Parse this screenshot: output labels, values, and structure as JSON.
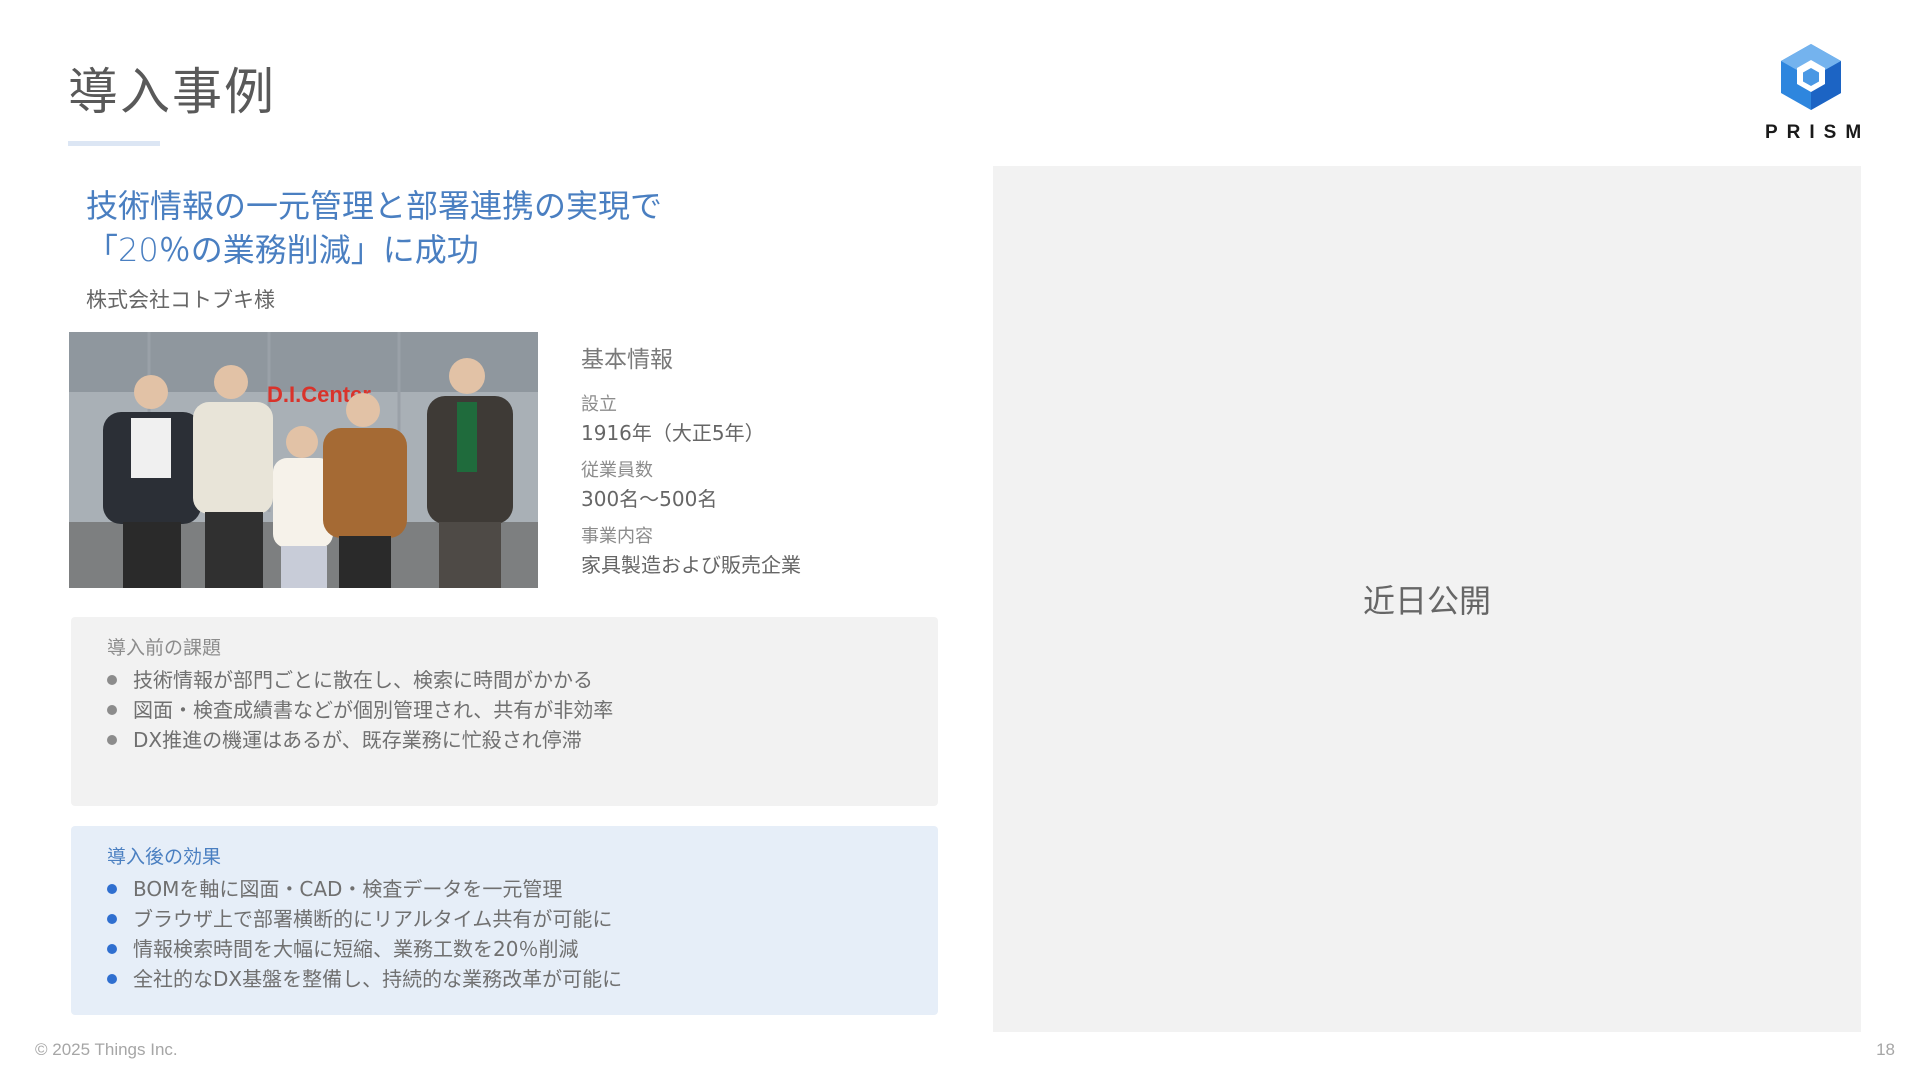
{
  "page": {
    "title": "導入事例",
    "logo_text": "PRISM",
    "footer": "© 2025 Things Inc.",
    "page_number": "18"
  },
  "case": {
    "headline_line1": "技術情報の一元管理と部署連携の実現で",
    "headline_line2": "「20％の業務削減」に成功",
    "company": "株式会社コトブキ様",
    "photo_sign": "D.I.Center"
  },
  "basic_info": {
    "heading": "基本情報",
    "items": [
      {
        "label": "設立",
        "value": "1916年（大正5年）"
      },
      {
        "label": "従業員数",
        "value": "300名～500名"
      },
      {
        "label": "事業内容",
        "value": "家具製造および販売企業"
      }
    ]
  },
  "before": {
    "title": "導入前の課題",
    "items": [
      "技術情報が部門ごとに散在し、検索に時間がかかる",
      "図面・検査成績書などが個別管理され、共有が非効率",
      "DX推進の機運はあるが、既存業務に忙殺され停滞"
    ]
  },
  "after": {
    "title": "導入後の効果",
    "items": [
      "BOMを軸に図面・CAD・検査データを一元管理",
      "ブラウザ上で部署横断的にリアルタイム共有が可能に",
      "情報検索時間を大幅に短縮、業務工数を20％削減",
      "全社的なDX基盤を整備し、持続的な業務改革が可能に"
    ]
  },
  "right": {
    "coming_soon": "近日公開"
  },
  "colors": {
    "accent": "#4a7fc1",
    "bullet_after": "#2f6fd0",
    "panel_gray": "#f2f2f2",
    "panel_blue": "#e6eef8"
  }
}
